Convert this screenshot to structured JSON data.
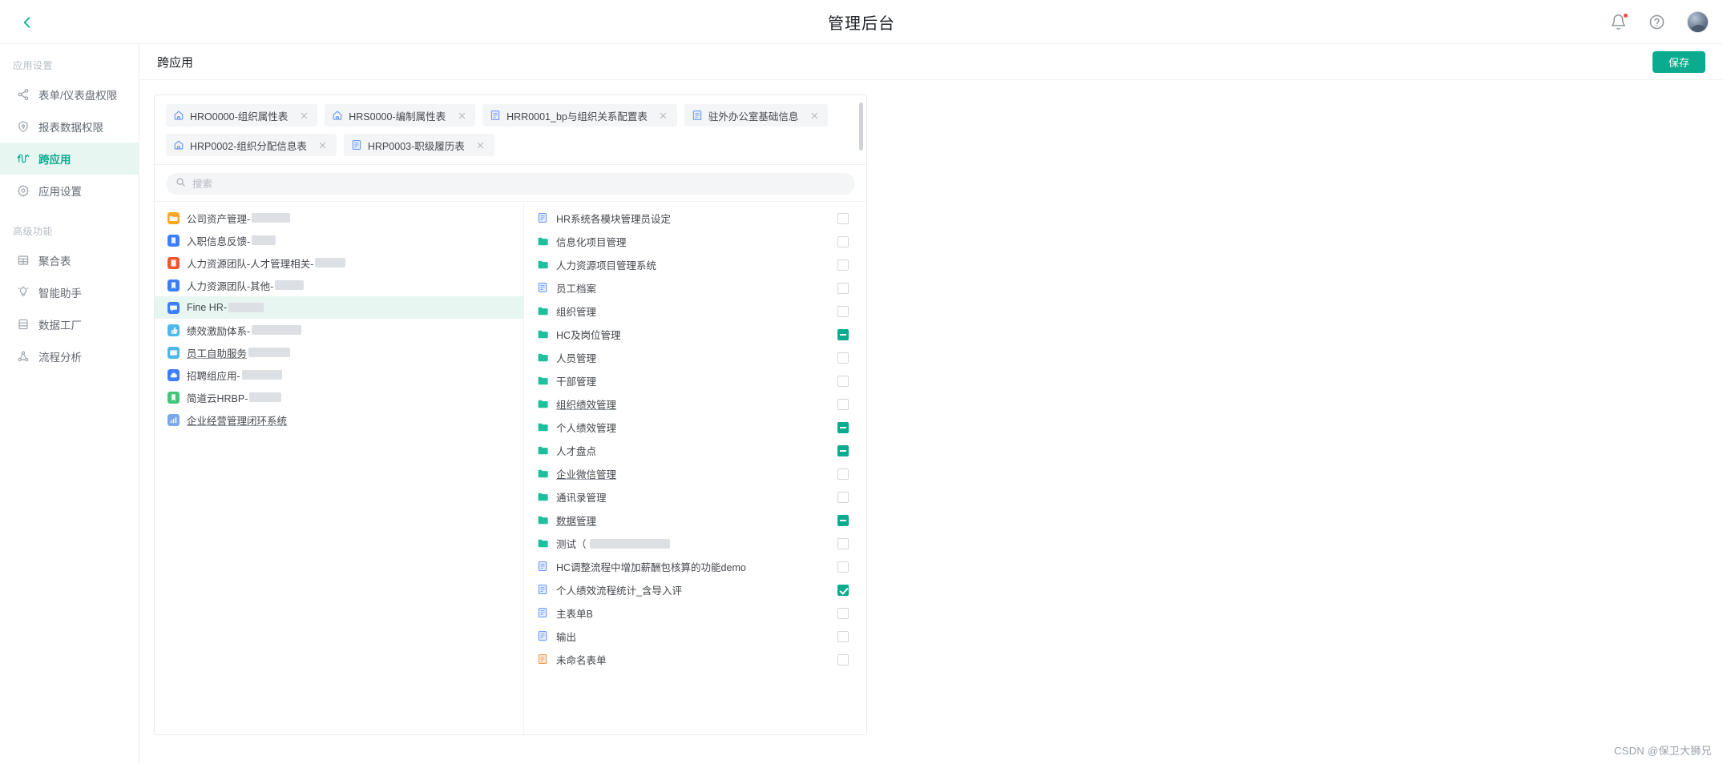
{
  "topbar": {
    "back_icon": "chevron-left-icon",
    "title": "管理后台",
    "bell_icon": "bell-icon",
    "help_icon": "help-circle-icon",
    "avatar": "user-avatar"
  },
  "sidebar": {
    "group1_title": "应用设置",
    "group2_title": "高级功能",
    "group1_items": [
      {
        "label": "表单/仪表盘权限",
        "icon": "share-nodes-icon",
        "active": false
      },
      {
        "label": "报表数据权限",
        "icon": "shield-icon",
        "active": false
      },
      {
        "label": "跨应用",
        "icon": "cross-app-icon",
        "active": true
      },
      {
        "label": "应用设置",
        "icon": "gear-icon",
        "active": false
      }
    ],
    "group2_items": [
      {
        "label": "聚合表",
        "icon": "table-icon",
        "active": false
      },
      {
        "label": "智能助手",
        "icon": "lightbulb-icon",
        "active": false
      },
      {
        "label": "数据工厂",
        "icon": "database-icon",
        "active": false
      },
      {
        "label": "流程分析",
        "icon": "flow-analysis-icon",
        "active": false
      }
    ]
  },
  "content_header": {
    "title": "跨应用",
    "save_label": "保存"
  },
  "tags": [
    {
      "label": "HRO0000-组织属性表",
      "icon": "home-icon"
    },
    {
      "label": "HRS0000-编制属性表",
      "icon": "home-icon"
    },
    {
      "label": "HRR0001_bp与组织关系配置表",
      "icon": "form-icon"
    },
    {
      "label": "驻外办公室基础信息",
      "icon": "form-icon"
    },
    {
      "label": "HRP0002-组织分配信息表",
      "icon": "home-icon"
    },
    {
      "label": "HRP0003-职级履历表",
      "icon": "form-icon"
    }
  ],
  "search": {
    "icon": "search-icon",
    "value": "",
    "placeholder": "搜索"
  },
  "app_list": [
    {
      "label": "公司资产管理-",
      "icon_color": "#f5a623",
      "icon": "app-folder-icon",
      "redacted": 48,
      "selected": false,
      "underline": false
    },
    {
      "label": "入职信息反馈-",
      "icon_color": "#3d7eff",
      "icon": "app-book-icon",
      "redacted": 30,
      "selected": false,
      "underline": false
    },
    {
      "label": "人力资源团队-人才管理相关-",
      "icon_color": "#f2542d",
      "icon": "app-doc-icon",
      "redacted": 38,
      "selected": false,
      "underline": false
    },
    {
      "label": "人力资源团队-其他-",
      "icon_color": "#3d7eff",
      "icon": "app-book-icon",
      "redacted": 36,
      "selected": false,
      "underline": false
    },
    {
      "label": "Fine HR-",
      "icon_color": "#3d7eff",
      "icon": "app-chat-icon",
      "redacted": 44,
      "selected": true,
      "underline": false
    },
    {
      "label": "绩效激励体系-",
      "icon_color": "#4fb8e8",
      "icon": "app-thumb-icon",
      "redacted": 62,
      "selected": false,
      "underline": false
    },
    {
      "label": "员工自助服务",
      "icon_color": "#4fb8e8",
      "icon": "app-card-icon",
      "redacted": 52,
      "selected": false,
      "underline": true
    },
    {
      "label": "招聘组应用-",
      "icon_color": "#3d7eff",
      "icon": "app-cloud-icon",
      "redacted": 50,
      "selected": false,
      "underline": false
    },
    {
      "label": "简道云HRBP-",
      "icon_color": "#43c47a",
      "icon": "app-bookmark-icon",
      "redacted": 40,
      "selected": false,
      "underline": false
    },
    {
      "label": "企业经营管理闭环系统",
      "icon_color": "#7aa8e8",
      "icon": "app-chart-icon",
      "redacted": 0,
      "selected": false,
      "underline": true
    }
  ],
  "tree_items": [
    {
      "label": "HR系统各模块管理员设定",
      "icon": "form-icon",
      "state": "unchecked",
      "underline": false
    },
    {
      "label": "信息化项目管理",
      "icon": "folder-icon",
      "state": "unchecked",
      "underline": false
    },
    {
      "label": "人力资源项目管理系统",
      "icon": "folder-icon",
      "state": "unchecked",
      "underline": false
    },
    {
      "label": "员工档案",
      "icon": "form-icon",
      "state": "unchecked",
      "underline": false
    },
    {
      "label": "组织管理",
      "icon": "folder-icon",
      "state": "unchecked",
      "underline": false
    },
    {
      "label": "HC及岗位管理",
      "icon": "folder-icon",
      "state": "indeterminate",
      "underline": false
    },
    {
      "label": "人员管理",
      "icon": "folder-icon",
      "state": "unchecked",
      "underline": false
    },
    {
      "label": "干部管理",
      "icon": "folder-icon",
      "state": "unchecked",
      "underline": false
    },
    {
      "label": "组织绩效管理",
      "icon": "folder-icon",
      "state": "unchecked",
      "underline": true
    },
    {
      "label": "个人绩效管理",
      "icon": "folder-icon",
      "state": "indeterminate",
      "underline": false
    },
    {
      "label": "人才盘点",
      "icon": "folder-icon",
      "state": "indeterminate",
      "underline": false
    },
    {
      "label": "企业微信管理",
      "icon": "folder-icon",
      "state": "unchecked",
      "underline": true
    },
    {
      "label": "通讯录管理",
      "icon": "folder-icon",
      "state": "unchecked",
      "underline": false
    },
    {
      "label": "数据管理",
      "icon": "folder-icon",
      "state": "indeterminate",
      "underline": true
    },
    {
      "label": "测试（",
      "icon": "folder-icon",
      "state": "unchecked",
      "underline": false,
      "redacted": 100
    },
    {
      "label": "HC调整流程中增加薪酬包核算的功能demo",
      "icon": "form-icon",
      "state": "unchecked",
      "underline": false
    },
    {
      "label": "个人绩效流程统计_含导入评",
      "icon": "form-icon",
      "state": "checked",
      "underline": false
    },
    {
      "label": "主表单B",
      "icon": "form-icon",
      "state": "unchecked",
      "underline": false
    },
    {
      "label": "输出",
      "icon": "form-icon",
      "state": "unchecked",
      "underline": false
    },
    {
      "label": "未命名表单",
      "icon": "form-orange-icon",
      "state": "unchecked",
      "underline": false
    }
  ],
  "watermark": "CSDN @保卫大狮兄",
  "colors": {
    "accent": "#0aab8e",
    "tag_bg": "#f4f5f7",
    "selected_row": "#e8f6f2"
  }
}
